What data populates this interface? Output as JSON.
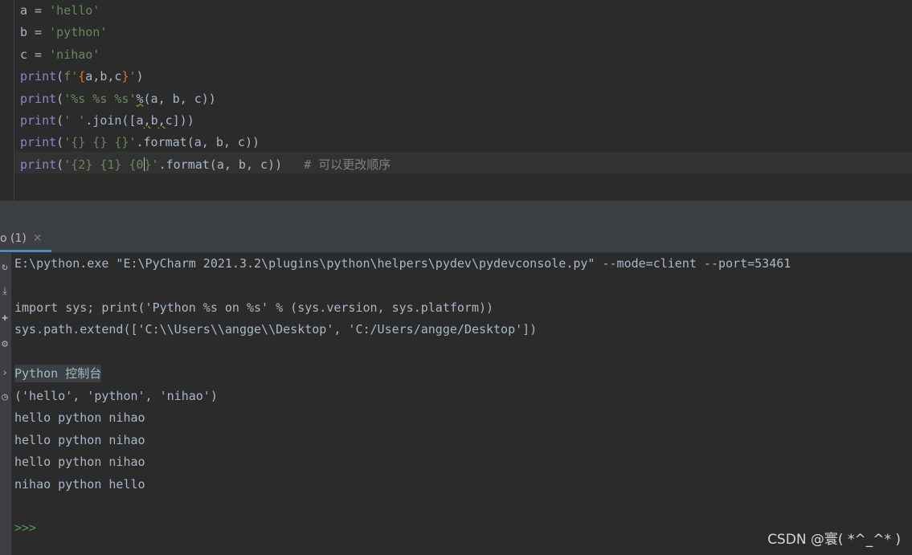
{
  "editor": {
    "lines": [
      {
        "segments": [
          {
            "t": "a = ",
            "c": "op"
          },
          {
            "t": "'hello'",
            "c": "str"
          }
        ]
      },
      {
        "segments": [
          {
            "t": "b = ",
            "c": "op"
          },
          {
            "t": "'python'",
            "c": "str"
          }
        ]
      },
      {
        "segments": [
          {
            "t": "c = ",
            "c": "op"
          },
          {
            "t": "'nihao'",
            "c": "str"
          }
        ]
      },
      {
        "segments": [
          {
            "t": "print",
            "c": "kw"
          },
          {
            "t": "(",
            "c": "op"
          },
          {
            "t": "f'",
            "c": "str"
          },
          {
            "t": "{",
            "c": "brace"
          },
          {
            "t": "a,b,c",
            "c": "op"
          },
          {
            "t": "}",
            "c": "brace"
          },
          {
            "t": "'",
            "c": "str"
          },
          {
            "t": ")",
            "c": "op"
          }
        ]
      },
      {
        "segments": [
          {
            "t": "print",
            "c": "kw"
          },
          {
            "t": "(",
            "c": "op"
          },
          {
            "t": "'%s %s %s'",
            "c": "str"
          },
          {
            "t": "%",
            "c": "op squiggle"
          },
          {
            "t": "(a, b, c))",
            "c": "op"
          }
        ]
      },
      {
        "segments": [
          {
            "t": "print",
            "c": "kw"
          },
          {
            "t": "(",
            "c": "op"
          },
          {
            "t": "' '",
            "c": "str"
          },
          {
            "t": ".join([a",
            "c": "op"
          },
          {
            "t": ",",
            "c": "op squiggle"
          },
          {
            "t": "b",
            "c": "op"
          },
          {
            "t": ",",
            "c": "op squiggle"
          },
          {
            "t": "c]))",
            "c": "op"
          }
        ]
      },
      {
        "segments": [
          {
            "t": "print",
            "c": "kw"
          },
          {
            "t": "(",
            "c": "op"
          },
          {
            "t": "'{} {} {}'",
            "c": "str"
          },
          {
            "t": ".format(a, b, c))",
            "c": "op"
          }
        ]
      },
      {
        "segments": [
          {
            "t": "print",
            "c": "kw"
          },
          {
            "t": "(",
            "c": "op"
          },
          {
            "t": "'{2} {1} {0",
            "c": "str"
          },
          {
            "t": "",
            "c": "caret"
          },
          {
            "t": "}'",
            "c": "str"
          },
          {
            "t": ".format(a, b, c))",
            "c": "op"
          },
          {
            "t": "   # 可以更改顺序",
            "c": "comment"
          }
        ]
      }
    ]
  },
  "run_tab": {
    "label": "o (1)",
    "close_glyph": "✕"
  },
  "toolstrip_icons": [
    "rerun-icon",
    "download-icon",
    "pin-icon",
    "settings-icon",
    "execute-icon",
    "history-icon"
  ],
  "console": {
    "lines": [
      "E:\\python.exe \"E:\\PyCharm 2021.3.2\\plugins\\python\\helpers\\pydev\\pydevconsole.py\" --mode=client --port=53461",
      "",
      "import sys; print('Python %s on %s' % (sys.version, sys.platform))",
      "sys.path.extend(['C:\\\\Users\\\\angge\\\\Desktop', 'C:/Users/angge/Desktop'])",
      "",
      "Python 控制台",
      "('hello', 'python', 'nihao')",
      "hello python nihao",
      "hello python nihao",
      "hello python nihao",
      "nihao python hello",
      "",
      ">>>"
    ]
  },
  "watermark": "CSDN @寰( *^_^* )"
}
